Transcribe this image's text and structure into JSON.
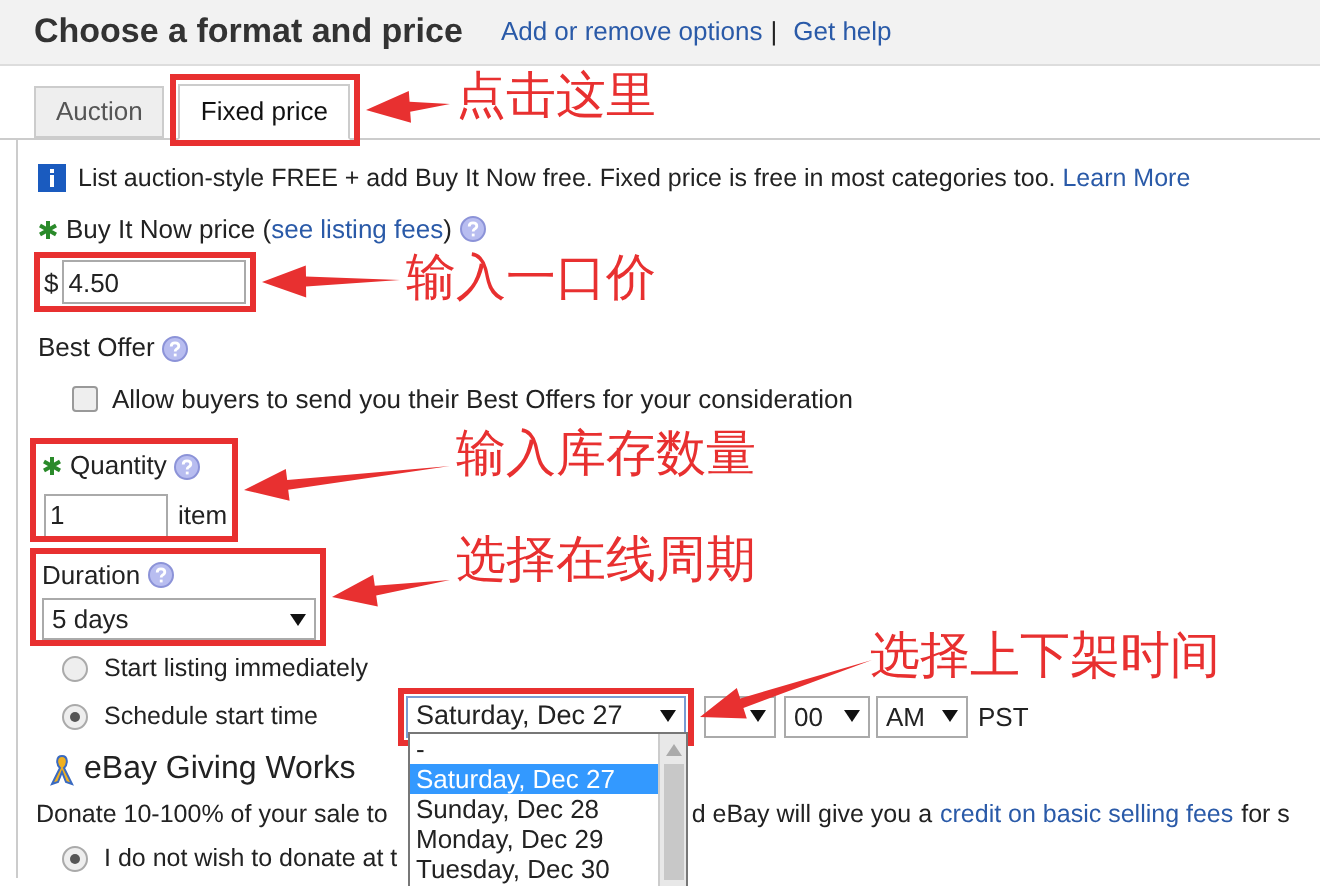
{
  "header": {
    "title": "Choose a format and price",
    "links": [
      "Add or remove options",
      "Get help"
    ],
    "separator": "|"
  },
  "tabs": [
    {
      "label": "Auction",
      "selected": false
    },
    {
      "label": "Fixed price",
      "selected": true
    }
  ],
  "info": {
    "text": "List auction-style FREE + add Buy It Now free. Fixed price is free in most categories too.",
    "link": "Learn More"
  },
  "buy_it_now": {
    "label": "Buy It Now price (",
    "link": "see listing fees",
    "label_end": ")",
    "currency": "$",
    "value": "4.50",
    "required": true
  },
  "best_offer": {
    "label": "Best Offer",
    "checkbox": {
      "label": "Allow buyers to send you their Best Offers for your consideration",
      "checked": false
    }
  },
  "quantity": {
    "label": "Quantity",
    "value": "1",
    "unit": "item",
    "required": true
  },
  "duration": {
    "label": "Duration",
    "value": "5 days"
  },
  "start": {
    "options": [
      {
        "label": "Start listing immediately",
        "selected": false
      },
      {
        "label": "Schedule start time",
        "selected": true
      }
    ],
    "date": "Saturday, Dec 27",
    "minute": "00",
    "ampm": "AM",
    "timezone": "PST",
    "dropdown": [
      {
        "label": "-",
        "selected": false
      },
      {
        "label": "Saturday, Dec 27",
        "selected": true
      },
      {
        "label": "Sunday, Dec 28",
        "selected": false
      },
      {
        "label": "Monday, Dec 29",
        "selected": false
      },
      {
        "label": "Tuesday, Dec 30",
        "selected": false
      }
    ]
  },
  "giving_works": {
    "title": "eBay Giving Works",
    "text_start": "Donate 10-100% of your sale to",
    "text_end": "d eBay will give you a",
    "link": "credit on basic selling fees",
    "text_after": "for s",
    "option": {
      "label": "I do not wish to donate at t",
      "selected": true
    }
  },
  "annotations": [
    {
      "label": "点击这里"
    },
    {
      "label": "输入一口价"
    },
    {
      "label": "输入库存数量"
    },
    {
      "label": "选择在线周期"
    },
    {
      "label": "选择上下架时间"
    }
  ]
}
